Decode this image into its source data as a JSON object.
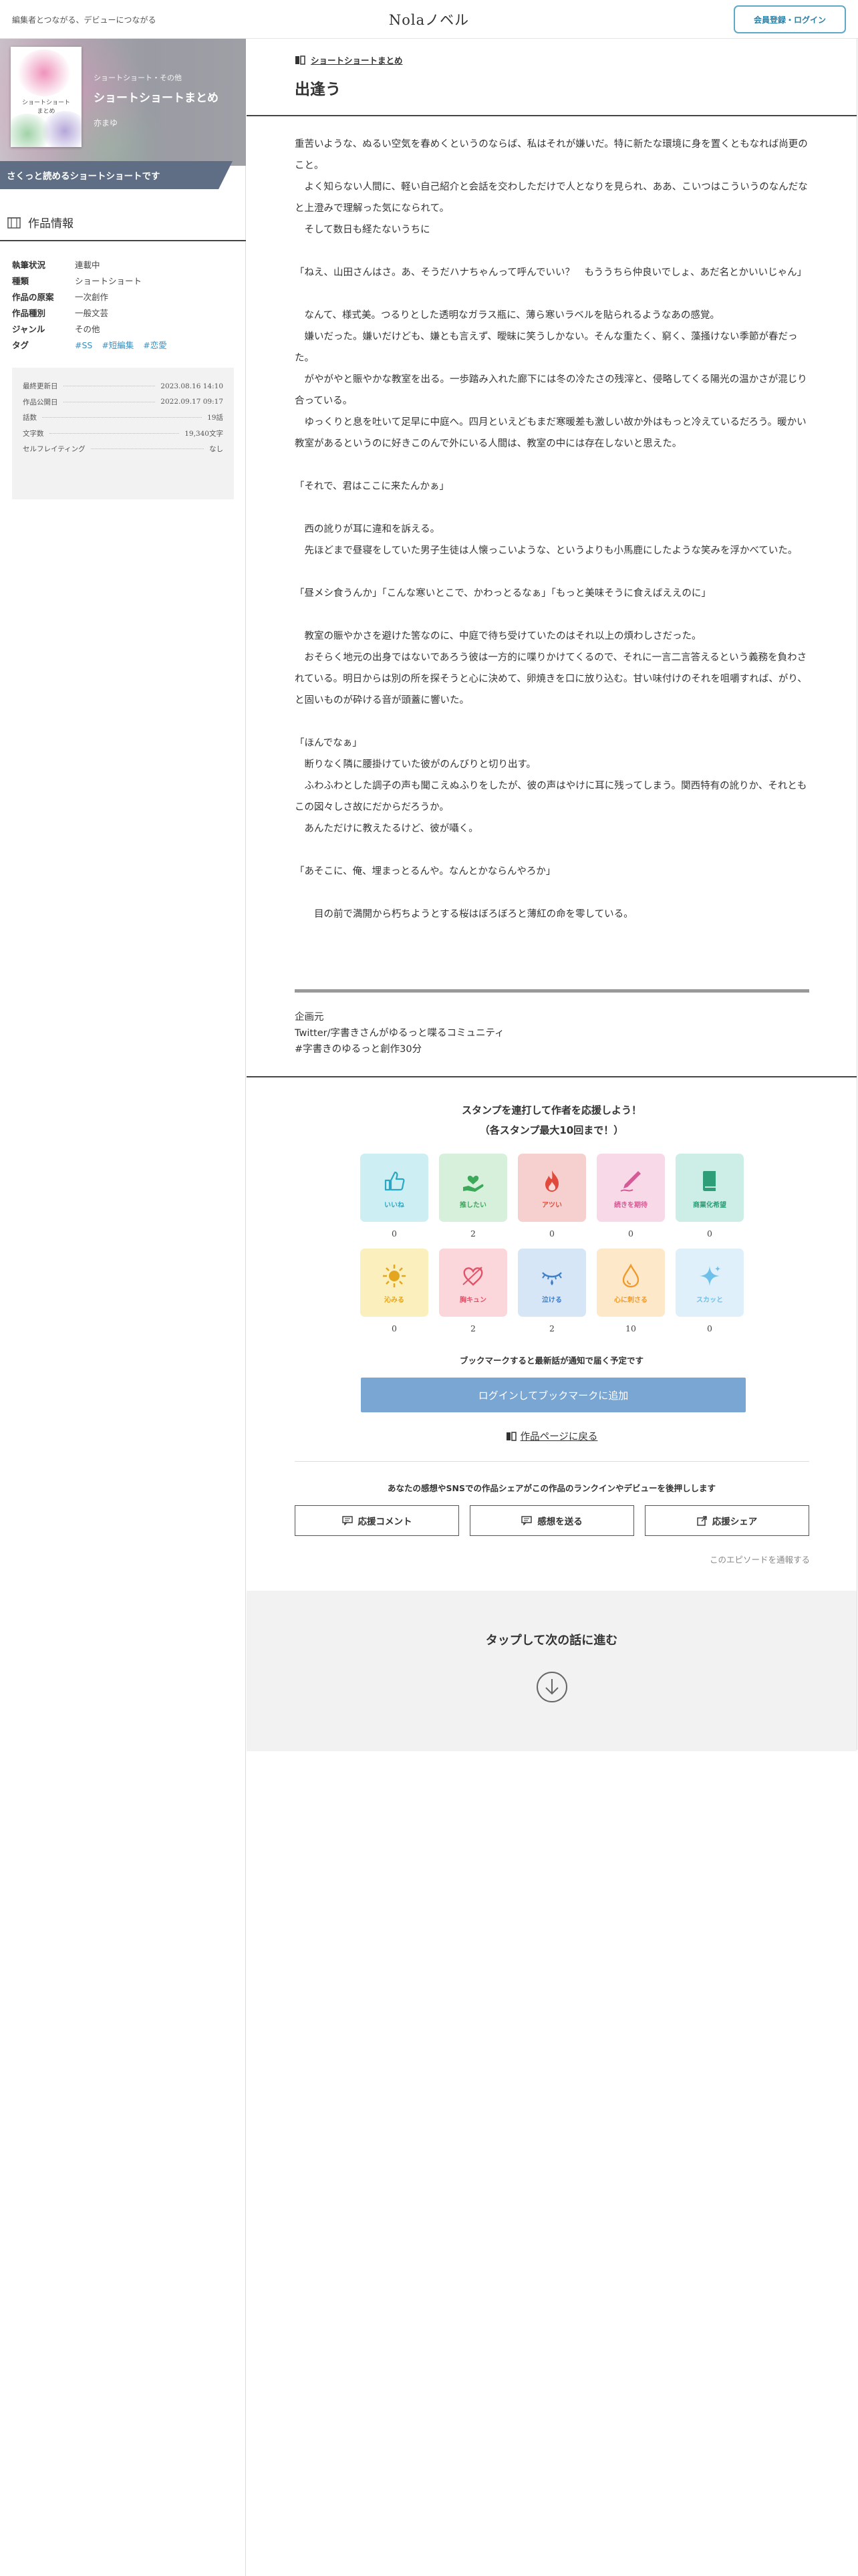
{
  "header": {
    "tagline": "編集者とつながる、デビューにつながる",
    "brand": "Nolaノベル",
    "login_label": "会員登録・ログイン"
  },
  "work": {
    "cover_text": "ショートショート\nまとめ",
    "series": "ショートショート・その他",
    "title": "ショートショートまとめ",
    "author": "亦まゆ",
    "catchcopy": "さくっと読めるショートショートです"
  },
  "info": {
    "section_title": "作品情報",
    "rows": [
      {
        "k": "執筆状況",
        "v": "連載中"
      },
      {
        "k": "種類",
        "v": "ショートショート"
      },
      {
        "k": "作品の原案",
        "v": "一次創作"
      },
      {
        "k": "作品種別",
        "v": "一般文芸"
      },
      {
        "k": "ジャンル",
        "v": "その他"
      }
    ],
    "tag_key": "タグ",
    "tags": [
      "#SS",
      "#短編集",
      "#恋愛"
    ]
  },
  "stats": [
    {
      "k": "最終更新日",
      "v": "2023.08.16 14:10"
    },
    {
      "k": "作品公開日",
      "v": "2022.09.17 09:17"
    },
    {
      "k": "話数",
      "v": "19話"
    },
    {
      "k": "文字数",
      "v": "19,340文字"
    },
    {
      "k": "セルフレイティング",
      "v": "なし"
    }
  ],
  "episode": {
    "breadcrumb": "ショートショートまとめ",
    "title": "出逢う",
    "paragraphs": [
      "重苦いような、ぬるい空気を春めくというのならば、私はそれが嫌いだ。特に新たな環境に身を置くともなれば尚更のこと。",
      "　よく知らない人間に、軽い自己紹介と会話を交わしただけで人となりを見られ、ああ、こいつはこういうのなんだなと上澄みで理解った気になられて。",
      "　そして数日も経たないうちに",
      "",
      "「ねえ、山田さんはさ。あ、そうだハナちゃんって呼んでいい？　もううちら仲良いでしょ、あだ名とかいいじゃん」",
      "",
      "　なんて、様式美。つるりとした透明なガラス瓶に、薄ら寒いラベルを貼られるようなあの感覚。",
      "　嫌いだった。嫌いだけども、嫌とも言えず、曖昧に笑うしかない。そんな重たく、窮く、藻掻けない季節が春だった。",
      "　がやがやと賑やかな教室を出る。一歩踏み入れた廊下には冬の冷たさの残滓と、侵略してくる陽光の温かさが混じり合っている。",
      "　ゆっくりと息を吐いて足早に中庭へ。四月といえどもまだ寒暖差も激しい故か外はもっと冷えているだろう。暖かい教室があるというのに好きこのんで外にいる人間は、教室の中には存在しないと思えた。",
      "",
      "「それで、君はここに来たんかぁ」",
      "",
      "　西の訛りが耳に違和を訴える。",
      "　先ほどまで昼寝をしていた男子生徒は人懐っこいような、というよりも小馬鹿にしたような笑みを浮かべていた。",
      "",
      "「昼メシ食うんか」「こんな寒いとこで、かわっとるなぁ」「もっと美味そうに食えばええのに」",
      "",
      "　教室の賑やかさを避けた筈なのに、中庭で待ち受けていたのはそれ以上の煩わしさだった。",
      "　おそらく地元の出身ではないであろう彼は一方的に喋りかけてくるので、それに一言二言答えるという義務を負わされている。明日からは別の所を探そうと心に決めて、卵焼きを口に放り込む。甘い味付けのそれを咀嚼すれば、がり、と固いものが砕ける音が頭蓋に響いた。",
      "",
      "「ほんでなぁ」",
      "　断りなく隣に腰掛けていた彼がのんびりと切り出す。",
      "　ふわふわとした調子の声も聞こえぬふりをしたが、彼の声はやけに耳に残ってしまう。関西特有の訛りか、それともこの図々しさ故にだからだろうか。",
      "　あんただけに教えたるけど、彼が囁く。",
      "",
      "「あそこに、俺、埋まっとるんや。なんとかならんやろか」",
      "",
      "　　目の前で満開から朽ちようとする桜はぼろぼろと薄紅の命を零している。"
    ],
    "afterword": [
      "企画元",
      "Twitter/字書きさんがゆるっと喋るコミュニティ",
      "#字書きのゆるっと創作30分"
    ]
  },
  "stamps": {
    "heading_1": "スタンプを連打して作者を応援しよう！",
    "heading_2": "（各スタンプ最大10回まで！）",
    "items": [
      {
        "label": "いいね",
        "count": "0",
        "bg": "#cdeef2",
        "color": "#2aa7c4",
        "icon": "thumbs-up-icon"
      },
      {
        "label": "推したい",
        "count": "2",
        "bg": "#d6f0dc",
        "color": "#3ba85a",
        "icon": "hand-heart-icon"
      },
      {
        "label": "アツい",
        "count": "0",
        "bg": "#f6cfcf",
        "color": "#e04b3b",
        "icon": "flame-icon"
      },
      {
        "label": "続きを期待",
        "count": "0",
        "bg": "#f8d9e8",
        "color": "#d65a95",
        "icon": "pen-nib-icon"
      },
      {
        "label": "商業化希望",
        "count": "0",
        "bg": "#cdeee6",
        "color": "#2e9e78",
        "icon": "book-icon"
      },
      {
        "label": "沁みる",
        "count": "0",
        "bg": "#fbf0bd",
        "color": "#e4a51f",
        "icon": "sun-icon"
      },
      {
        "label": "胸キュン",
        "count": "2",
        "bg": "#fbd7dc",
        "color": "#e2536a",
        "icon": "heart-arrow-icon"
      },
      {
        "label": "泣ける",
        "count": "2",
        "bg": "#d7e6f7",
        "color": "#3e7fc8",
        "icon": "crying-eye-icon"
      },
      {
        "label": "心に刺さる",
        "count": "10",
        "bg": "#fde8c9",
        "color": "#ef9a2c",
        "icon": "drop-icon"
      },
      {
        "label": "スカッと",
        "count": "0",
        "bg": "#dff0fa",
        "color": "#6cc0ea",
        "icon": "sparkle-icon"
      }
    ]
  },
  "bookmark": {
    "note": "ブックマークすると最新話が通知で届く予定です",
    "button": "ログインしてブックマークに追加",
    "back": "作品ページに戻る"
  },
  "share": {
    "note": "あなたの感想やSNSでの作品シェアがこの作品のランクインやデビューを後押しします",
    "buttons": [
      "応援コメント",
      "感想を送る",
      "応援シェア"
    ],
    "report": "このエピソードを通報する"
  },
  "next": {
    "label": "タップして次の話に進む"
  },
  "colors": {
    "accent": "#5fa8c8",
    "bookmark_button": "#79a6d2",
    "catch_banner": "#5f6e84",
    "tag": "#3b8fbe"
  }
}
